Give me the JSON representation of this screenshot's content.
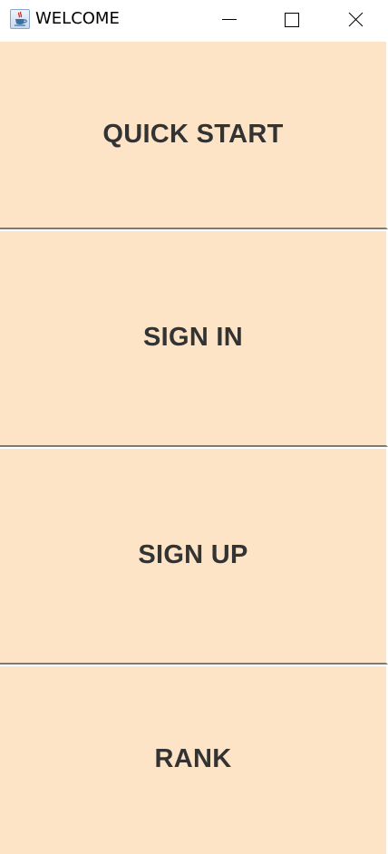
{
  "window": {
    "title": "WELCOME",
    "icon": "java-cup-icon",
    "controls": [
      "minimize-icon",
      "maximize-icon",
      "close-icon"
    ]
  },
  "menu": {
    "quick_start": "QUICK START",
    "sign_in": "SIGN IN",
    "sign_up": "SIGN UP",
    "rank": "RANK"
  },
  "colors": {
    "button_background": "#fde4c6",
    "button_text": "#333333",
    "separator": "#7b7b7b",
    "titlebar": "#ffffff"
  }
}
